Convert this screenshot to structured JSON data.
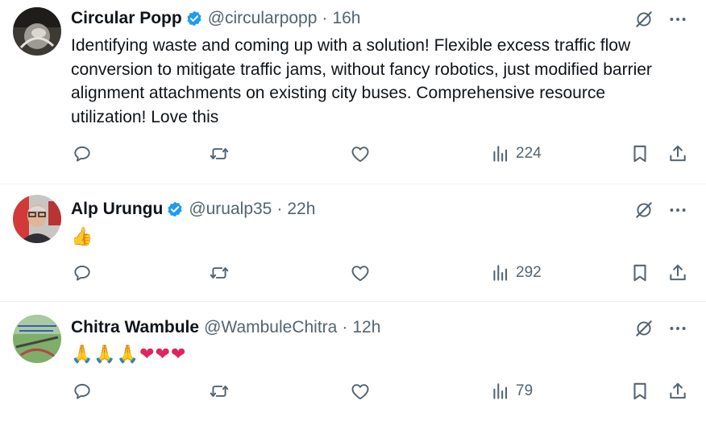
{
  "colors": {
    "text": "#0f1419",
    "secondary": "#536471",
    "verified": "#1d9bf0",
    "heart": "#e0245e"
  },
  "tweets": [
    {
      "name": "Circular Popp",
      "handle": "@circularpopp",
      "separator": "·",
      "time": "16h",
      "verified": true,
      "text": "Identifying waste and coming up with a solution!  Flexible excess traffic flow conversion to mitigate traffic jams, without fancy robotics, just modified barrier alignment attachments on existing city buses. Comprehensive resource utilization!  Love this",
      "views": "224",
      "icons": [
        "reply-icon",
        "retweet-icon",
        "like-icon",
        "views-icon",
        "bookmark-icon",
        "share-icon"
      ]
    },
    {
      "name": "Alp Urungu",
      "handle": "@urualp35",
      "separator": "·",
      "time": "22h",
      "verified": true,
      "text": "👍",
      "views": "292",
      "icons": [
        "reply-icon",
        "retweet-icon",
        "like-icon",
        "views-icon",
        "bookmark-icon",
        "share-icon"
      ]
    },
    {
      "name": "Chitra Wambule",
      "handle": "@WambuleChitra",
      "separator": "·",
      "time": "12h",
      "verified": false,
      "text": "🙏🙏🙏❤❤❤",
      "views": "79",
      "icons": [
        "reply-icon",
        "retweet-icon",
        "like-icon",
        "views-icon",
        "bookmark-icon",
        "share-icon"
      ]
    }
  ]
}
